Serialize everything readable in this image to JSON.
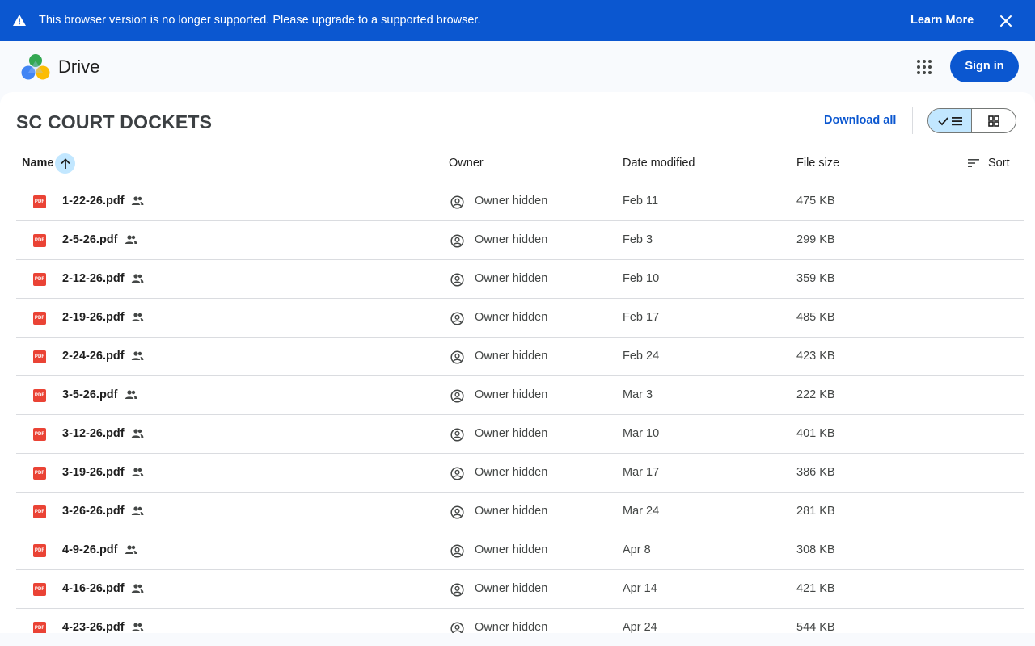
{
  "banner": {
    "message": "This browser version is no longer supported. Please upgrade to a supported browser.",
    "learn_more": "Learn More",
    "warning_icon": "warning-icon",
    "close_icon": "close-icon"
  },
  "header": {
    "brand": "Drive",
    "sign_in": "Sign in",
    "apps_icon": "apps-grid-icon"
  },
  "folder": {
    "title": "SC COURT DOCKETS",
    "download_all": "Download all",
    "view_mode": "list"
  },
  "columns": {
    "name": "Name",
    "owner": "Owner",
    "date": "Date modified",
    "size": "File size",
    "sort": "Sort"
  },
  "files": [
    {
      "name": "1-22-26.pdf",
      "owner": "Owner hidden",
      "date": "Feb 11",
      "size": "475 KB"
    },
    {
      "name": "2-5-26.pdf",
      "owner": "Owner hidden",
      "date": "Feb 3",
      "size": "299 KB"
    },
    {
      "name": "2-12-26.pdf",
      "owner": "Owner hidden",
      "date": "Feb 10",
      "size": "359 KB"
    },
    {
      "name": "2-19-26.pdf",
      "owner": "Owner hidden",
      "date": "Feb 17",
      "size": "485 KB"
    },
    {
      "name": "2-24-26.pdf",
      "owner": "Owner hidden",
      "date": "Feb 24",
      "size": "423 KB"
    },
    {
      "name": "3-5-26.pdf",
      "owner": "Owner hidden",
      "date": "Mar 3",
      "size": "222 KB"
    },
    {
      "name": "3-12-26.pdf",
      "owner": "Owner hidden",
      "date": "Mar 10",
      "size": "401 KB"
    },
    {
      "name": "3-19-26.pdf",
      "owner": "Owner hidden",
      "date": "Mar 17",
      "size": "386 KB"
    },
    {
      "name": "3-26-26.pdf",
      "owner": "Owner hidden",
      "date": "Mar 24",
      "size": "281 KB"
    },
    {
      "name": "4-9-26.pdf",
      "owner": "Owner hidden",
      "date": "Apr 8",
      "size": "308 KB"
    },
    {
      "name": "4-16-26.pdf",
      "owner": "Owner hidden",
      "date": "Apr 14",
      "size": "421 KB"
    },
    {
      "name": "4-23-26.pdf",
      "owner": "Owner hidden",
      "date": "Apr 24",
      "size": "544 KB"
    }
  ],
  "file_icon_label": "PDF",
  "colors": {
    "primary": "#0b57d0",
    "selected": "#c2e7ff",
    "pdf_red": "#ea4335"
  }
}
